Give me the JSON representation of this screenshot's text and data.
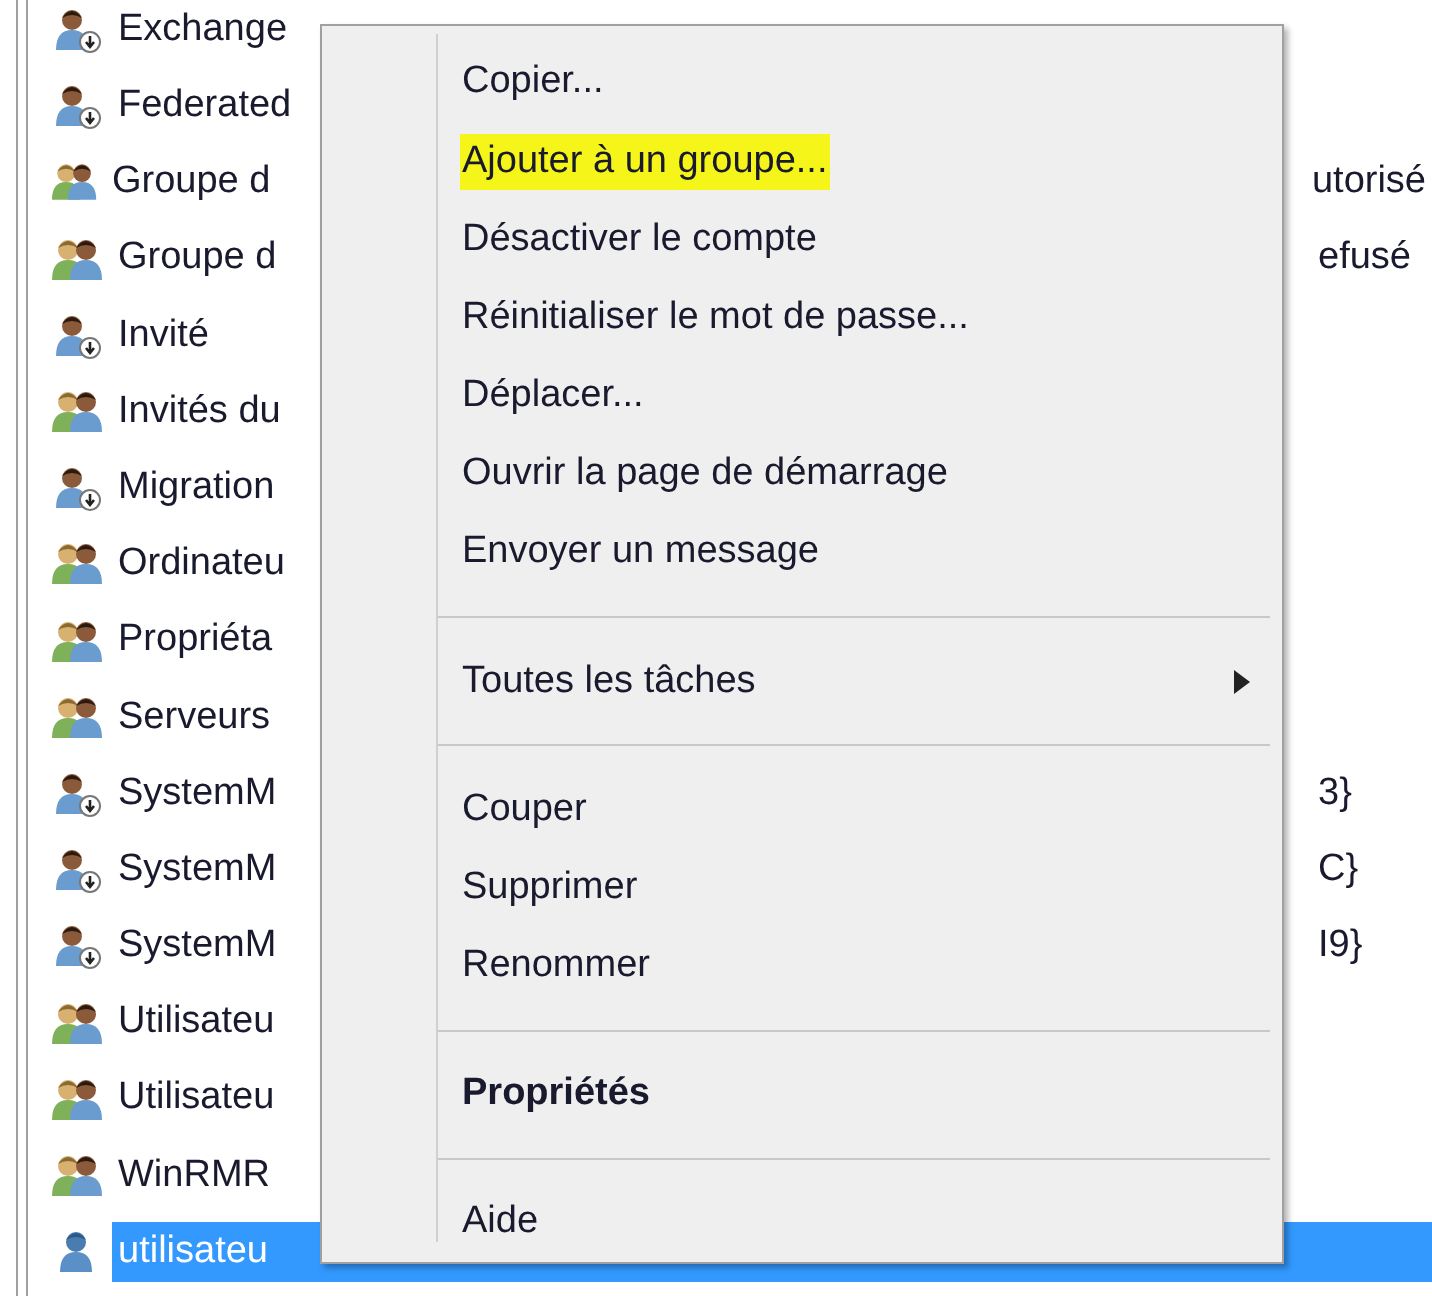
{
  "list": [
    {
      "kind": "user",
      "name": "Exchange",
      "selected": false
    },
    {
      "kind": "user",
      "name": "Federated",
      "selected": false
    },
    {
      "kind": "group",
      "name": "Groupe d",
      "tail": "utorisé",
      "selected": false
    },
    {
      "kind": "group",
      "name": "Groupe d",
      "tail": "efusé",
      "selected": false
    },
    {
      "kind": "user",
      "name": "Invité",
      "selected": false
    },
    {
      "kind": "group",
      "name": "Invités du",
      "selected": false
    },
    {
      "kind": "user",
      "name": "Migration",
      "selected": false
    },
    {
      "kind": "group",
      "name": "Ordinateu",
      "selected": false
    },
    {
      "kind": "group",
      "name": "Propriéta",
      "selected": false
    },
    {
      "kind": "group",
      "name": "Serveurs",
      "selected": false
    },
    {
      "kind": "user",
      "name": "SystemM",
      "tail": "3}",
      "selected": false
    },
    {
      "kind": "user",
      "name": "SystemM",
      "tail": "C}",
      "selected": false
    },
    {
      "kind": "user",
      "name": "SystemM",
      "tail": "I9}",
      "selected": false
    },
    {
      "kind": "group",
      "name": "Utilisateu",
      "selected": false
    },
    {
      "kind": "group",
      "name": "Utilisateu",
      "selected": false
    },
    {
      "kind": "group",
      "name": "WinRMR",
      "selected": false
    },
    {
      "kind": "person",
      "name": "utilisateu",
      "selected": true
    }
  ],
  "context_menu": [
    {
      "kind": "item",
      "label": "Copier...",
      "highlighted": false,
      "bold": false,
      "submenu": false
    },
    {
      "kind": "item",
      "label": "Ajouter à un groupe...",
      "highlighted": true,
      "bold": false,
      "submenu": false
    },
    {
      "kind": "item",
      "label": "Désactiver le compte",
      "highlighted": false,
      "bold": false,
      "submenu": false
    },
    {
      "kind": "item",
      "label": "Réinitialiser le mot de passe...",
      "highlighted": false,
      "bold": false,
      "submenu": false
    },
    {
      "kind": "item",
      "label": "Déplacer...",
      "highlighted": false,
      "bold": false,
      "submenu": false
    },
    {
      "kind": "item",
      "label": "Ouvrir la page de démarrage",
      "highlighted": false,
      "bold": false,
      "submenu": false
    },
    {
      "kind": "item",
      "label": "Envoyer un message",
      "highlighted": false,
      "bold": false,
      "submenu": false
    },
    {
      "kind": "separator"
    },
    {
      "kind": "item",
      "label": "Toutes les tâches",
      "highlighted": false,
      "bold": false,
      "submenu": true
    },
    {
      "kind": "separator"
    },
    {
      "kind": "item",
      "label": "Couper",
      "highlighted": false,
      "bold": false,
      "submenu": false
    },
    {
      "kind": "item",
      "label": "Supprimer",
      "highlighted": false,
      "bold": false,
      "submenu": false
    },
    {
      "kind": "item",
      "label": "Renommer",
      "highlighted": false,
      "bold": false,
      "submenu": false
    },
    {
      "kind": "separator"
    },
    {
      "kind": "item",
      "label": "Propriétés",
      "highlighted": false,
      "bold": true,
      "submenu": false
    },
    {
      "kind": "separator"
    },
    {
      "kind": "item",
      "label": "Aide",
      "highlighted": false,
      "bold": false,
      "submenu": false
    }
  ]
}
